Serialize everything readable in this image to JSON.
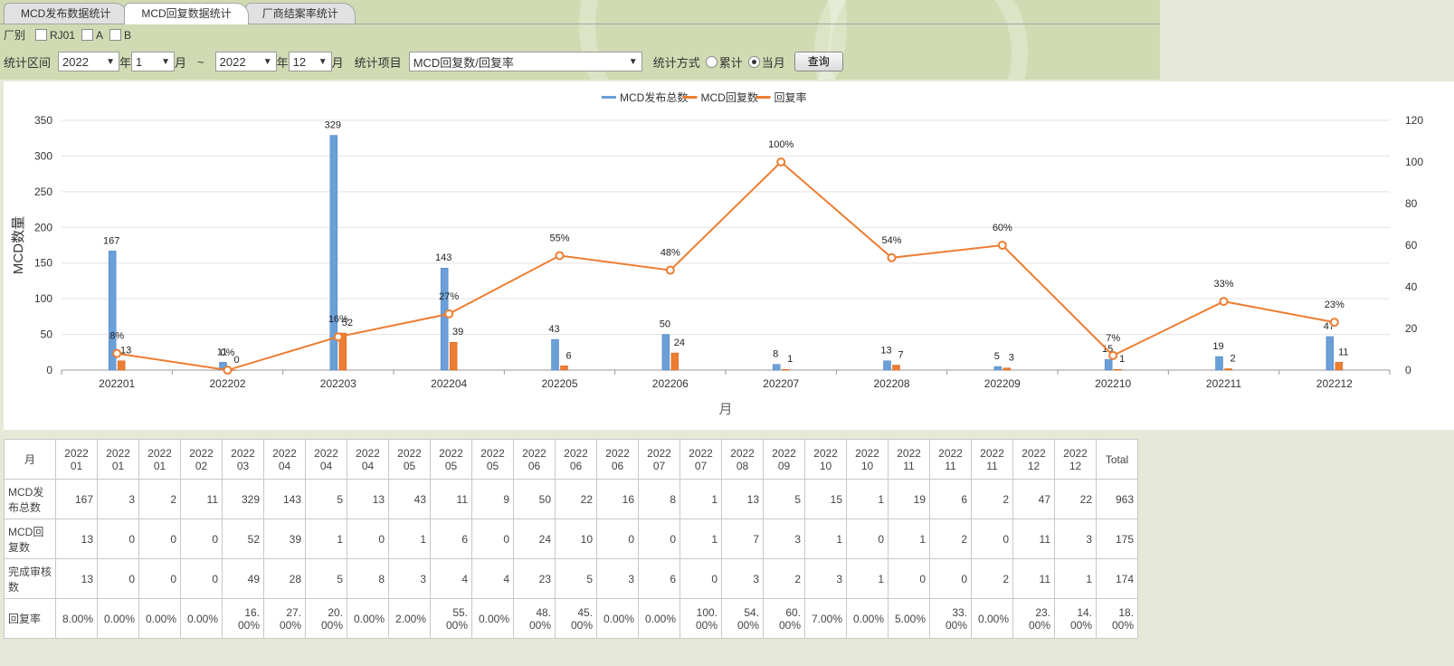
{
  "tabs": [
    {
      "label": "MCD发布数据统计",
      "active": false
    },
    {
      "label": "MCD回复数据统计",
      "active": true
    },
    {
      "label": "厂商结案率统计",
      "active": false
    }
  ],
  "filters": {
    "factory_label": "厂别",
    "factory_options": [
      "RJ01",
      "A",
      "B"
    ],
    "period_label": "统计区间",
    "start_year": "2022",
    "year_unit": "年",
    "start_month": "1",
    "month_unit": "月",
    "tilde": "~",
    "end_year": "2022",
    "end_month": "12",
    "item_label": "统计项目",
    "item_value": "MCD回复数/回复率",
    "method_label": "统计方式",
    "method_options": [
      "累计",
      "当月"
    ],
    "method_selected": "当月",
    "query_button": "查询"
  },
  "chart_data": {
    "type": "bar",
    "categories": [
      "202201",
      "202202",
      "202203",
      "202204",
      "202205",
      "202206",
      "202207",
      "202208",
      "202209",
      "202210",
      "202211",
      "202212"
    ],
    "series": [
      {
        "name": "MCD发布总数",
        "type": "bar",
        "values": [
          167,
          11,
          329,
          143,
          43,
          50,
          8,
          13,
          5,
          15,
          19,
          47
        ],
        "color": "#6a9fd8"
      },
      {
        "name": "MCD回复数",
        "type": "bar",
        "values": [
          13,
          0,
          52,
          39,
          6,
          24,
          1,
          7,
          3,
          1,
          2,
          11
        ],
        "color": "#ed7d31"
      },
      {
        "name": "回复率",
        "type": "line",
        "axis": "right",
        "values": [
          8,
          0,
          16,
          27,
          55,
          48,
          100,
          54,
          60,
          7,
          33,
          23
        ],
        "labels": [
          "8%",
          "0%",
          "16%",
          "27%",
          "55%",
          "48%",
          "100%",
          "54%",
          "60%",
          "7%",
          "33%",
          "23%"
        ],
        "color": "#ed7d31"
      }
    ],
    "xlabel": "月",
    "ylabel": "MCD数量",
    "ylim": [
      0,
      350
    ],
    "yticks": [
      0,
      50,
      100,
      150,
      200,
      250,
      300,
      350
    ],
    "y2lim": [
      0,
      120
    ],
    "y2ticks": [
      0,
      20,
      40,
      60,
      80,
      100,
      120
    ],
    "legend": "top-center",
    "grid": true
  },
  "table": {
    "header": "月",
    "columns": [
      "2022\n01",
      "2022\n01",
      "2022\n01",
      "2022\n02",
      "2022\n03",
      "2022\n04",
      "2022\n04",
      "2022\n04",
      "2022\n05",
      "2022\n05",
      "2022\n05",
      "2022\n06",
      "2022\n06",
      "2022\n06",
      "2022\n07",
      "2022\n07",
      "2022\n08",
      "2022\n09",
      "2022\n10",
      "2022\n10",
      "2022\n11",
      "2022\n11",
      "2022\n11",
      "2022\n12",
      "2022\n12",
      "Total"
    ],
    "rows": [
      {
        "label": "MCD发布总数",
        "values": [
          "167",
          "3",
          "2",
          "11",
          "329",
          "143",
          "5",
          "13",
          "43",
          "11",
          "9",
          "50",
          "22",
          "16",
          "8",
          "1",
          "13",
          "5",
          "15",
          "1",
          "19",
          "6",
          "2",
          "47",
          "22",
          "963"
        ]
      },
      {
        "label": "MCD回复数",
        "values": [
          "13",
          "0",
          "0",
          "0",
          "52",
          "39",
          "1",
          "0",
          "1",
          "6",
          "0",
          "24",
          "10",
          "0",
          "0",
          "1",
          "7",
          "3",
          "1",
          "0",
          "1",
          "2",
          "0",
          "11",
          "3",
          "175"
        ]
      },
      {
        "label": "完成审核数",
        "values": [
          "13",
          "0",
          "0",
          "0",
          "49",
          "28",
          "5",
          "8",
          "3",
          "4",
          "4",
          "23",
          "5",
          "3",
          "6",
          "0",
          "3",
          "2",
          "3",
          "1",
          "0",
          "0",
          "2",
          "11",
          "1",
          "174"
        ]
      },
      {
        "label": "回复率",
        "values": [
          "8.00%",
          "0.00%",
          "0.00%",
          "0.00%",
          "16.00%",
          "27.00%",
          "20.00%",
          "0.00%",
          "2.00%",
          "55.00%",
          "0.00%",
          "48.00%",
          "45.00%",
          "0.00%",
          "0.00%",
          "100.00%",
          "54.00%",
          "60.00%",
          "7.00%",
          "0.00%",
          "5.00%",
          "33.00%",
          "0.00%",
          "23.00%",
          "14.00%",
          "18.00%"
        ]
      }
    ]
  }
}
